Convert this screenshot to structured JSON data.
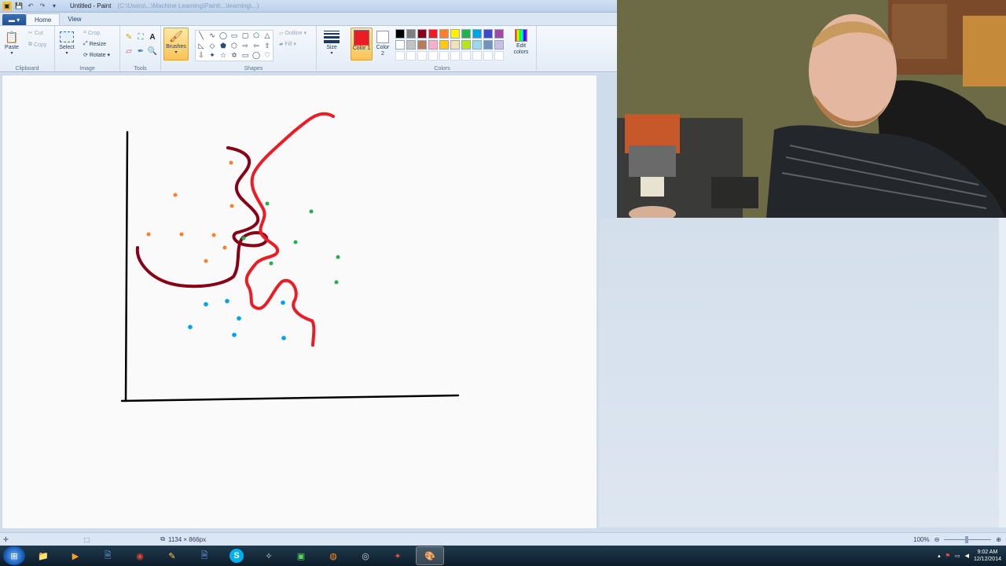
{
  "window": {
    "app_title": "Untitled - Paint",
    "title_path": "(C:\\Users\\...\\Machine Learning\\Paint\\...\\learning\\...)"
  },
  "tabs": [
    {
      "label": "Home",
      "active": true
    },
    {
      "label": "View",
      "active": false
    }
  ],
  "ribbon": {
    "clipboard": {
      "group_label": "Clipboard",
      "paste": "Paste",
      "cut": "Cut",
      "copy": "Copy"
    },
    "image": {
      "group_label": "Image",
      "select": "Select",
      "crop": "Crop",
      "resize": "Resize",
      "rotate": "Rotate"
    },
    "tools": {
      "group_label": "Tools"
    },
    "brushes": {
      "label": "Brushes"
    },
    "shapes": {
      "group_label": "Shapes",
      "outline": "Outline",
      "fill": "Fill"
    },
    "size": {
      "label": "Size"
    },
    "colors": {
      "group_label": "Colors",
      "color1_label": "Color 1",
      "color2_label": "Color 2",
      "edit_colors": "Edit colors",
      "color1": "#ed1c24",
      "color2": "#ffffff",
      "palette": [
        "#000000",
        "#7f7f7f",
        "#880015",
        "#ed1c24",
        "#ff7f27",
        "#fff200",
        "#22b14c",
        "#00a2e8",
        "#3f48cc",
        "#a349a4",
        "#ffffff",
        "#c3c3c3",
        "#b97a57",
        "#ffaec9",
        "#ffc90e",
        "#efe4b0",
        "#b5e61d",
        "#99d9ea",
        "#7092be",
        "#c8bfe7"
      ]
    }
  },
  "status": {
    "canvas_size": "1134 × 866px",
    "zoom": "100%"
  },
  "taskbar": {
    "time": "9:02 AM",
    "date": "12/12/2014"
  }
}
